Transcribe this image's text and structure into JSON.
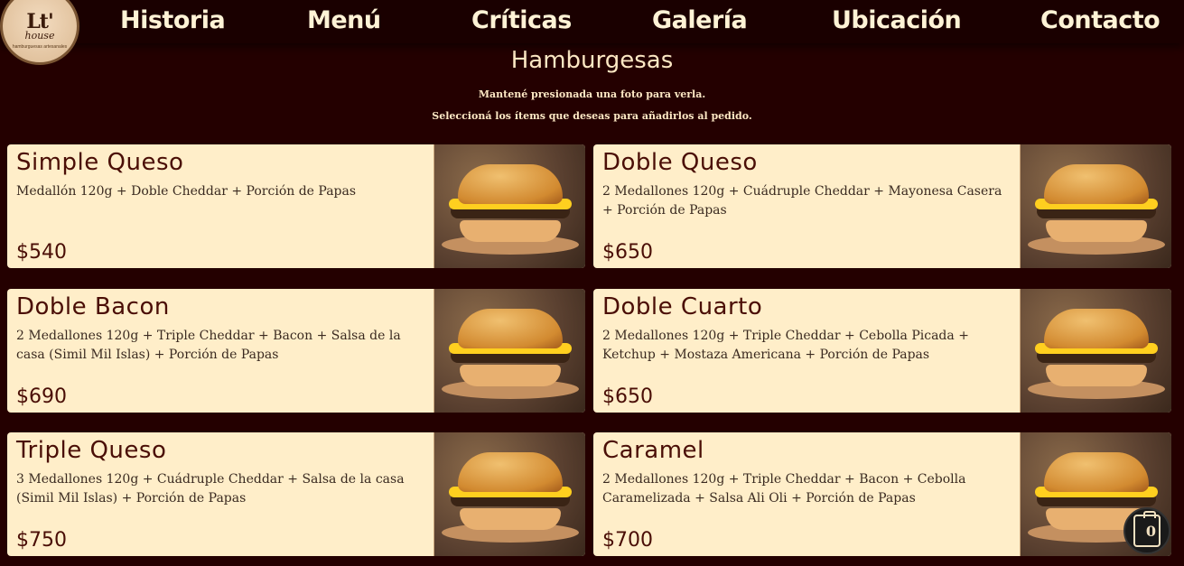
{
  "logo": {
    "main": "Lt'",
    "sub": "house",
    "tag": "hamburguesas artesanales"
  },
  "nav": [
    {
      "label": "Historia"
    },
    {
      "label": "Menú"
    },
    {
      "label": "Críticas"
    },
    {
      "label": "Galería"
    },
    {
      "label": "Ubicación"
    },
    {
      "label": "Contacto"
    }
  ],
  "section": {
    "title": "Hamburgesas",
    "hint1": "Mantené presionada una foto para verla.",
    "hint2": "Seleccioná los ítems que deseas para añadirlos al pedido."
  },
  "items": [
    {
      "name": "Simple Queso",
      "desc": "Medallón 120g + Doble Cheddar + Porción de Papas",
      "price": "$540"
    },
    {
      "name": "Doble Queso",
      "desc": "2 Medallones 120g + Cuádruple Cheddar + Mayonesa Casera + Porción de Papas",
      "price": "$650"
    },
    {
      "name": "Doble Bacon",
      "desc": "2 Medallones 120g + Triple Cheddar + Bacon + Salsa de la casa (Simil Mil Islas) + Porción de Papas",
      "price": "$690"
    },
    {
      "name": "Doble Cuarto",
      "desc": "2 Medallones 120g + Triple Cheddar + Cebolla Picada + Ketchup + Mostaza Americana + Porción de Papas",
      "price": "$650"
    },
    {
      "name": "Triple Queso",
      "desc": "3 Medallones 120g + Cuádruple Cheddar + Salsa de la casa (Simil Mil Islas) + Porción de Papas",
      "price": "$750"
    },
    {
      "name": "Caramel",
      "desc": "2 Medallones 120g + Triple Cheddar + Bacon + Cebolla Caramelizada + Salsa Ali Oli + Porción de Papas",
      "price": "$700"
    }
  ],
  "order": {
    "count": "0",
    "icon": "clipboard-icon"
  },
  "colors": {
    "background": "#240000",
    "card": "#ffeec9",
    "accent": "#4a0e06",
    "nav_text": "#fff3d6"
  }
}
